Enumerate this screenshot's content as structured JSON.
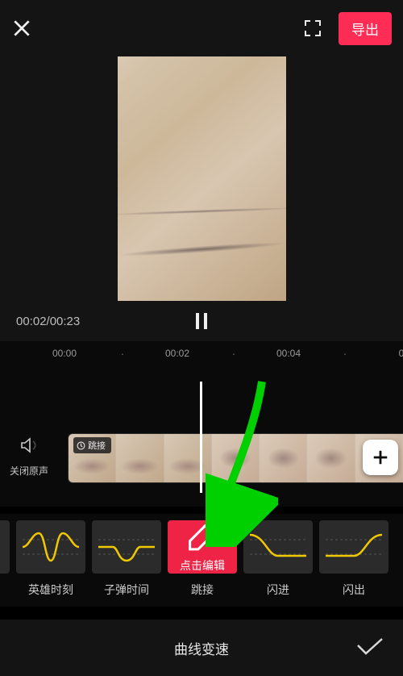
{
  "top": {
    "export_label": "导出"
  },
  "transport": {
    "time": "00:02/00:23"
  },
  "ruler": {
    "ticks": {
      "t0": "00:00",
      "t1": "00:02",
      "t2": "00:04"
    }
  },
  "mute": {
    "label": "关闭原声"
  },
  "clip": {
    "tag": "跳接"
  },
  "presets": {
    "p1": "英雄时刻",
    "p2": "子弹时间",
    "p3": "跳接",
    "p4": "闪进",
    "p5": "闪出",
    "edit_label": "点击编辑"
  },
  "bottom": {
    "title": "曲线变速"
  }
}
